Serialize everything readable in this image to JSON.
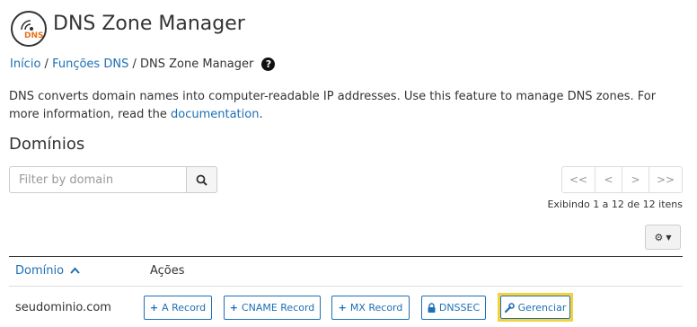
{
  "header": {
    "title": "DNS Zone Manager",
    "logo_text": "DNS"
  },
  "breadcrumb": {
    "home": "Início",
    "separator": "/",
    "section": "Funções DNS",
    "current": "DNS Zone Manager",
    "help": "?"
  },
  "description": {
    "text": "DNS converts domain names into computer-readable IP addresses. Use this feature to manage DNS zones. For more information, read the ",
    "link": "documentation",
    "after": "."
  },
  "domains": {
    "heading": "Domínios",
    "search": {
      "placeholder": "Filter by domain",
      "value": ""
    },
    "pager": {
      "first": "<<",
      "prev": "<",
      "next": ">",
      "last": ">>"
    },
    "showing": "Exibindo 1 a 12 de 12 itens",
    "columns": {
      "domain": "Domínio",
      "actions": "Ações"
    },
    "rows": [
      {
        "domain": "seudominio.com",
        "actions": {
          "a": "A Record",
          "cname": "CNAME Record",
          "mx": "MX Record",
          "dnssec": "DNSSEC",
          "manage": "Gerenciar"
        }
      }
    ]
  },
  "colors": {
    "link": "#1e6fb5",
    "highlight": "#f2d33d",
    "logo_accent": "#e8711b"
  }
}
